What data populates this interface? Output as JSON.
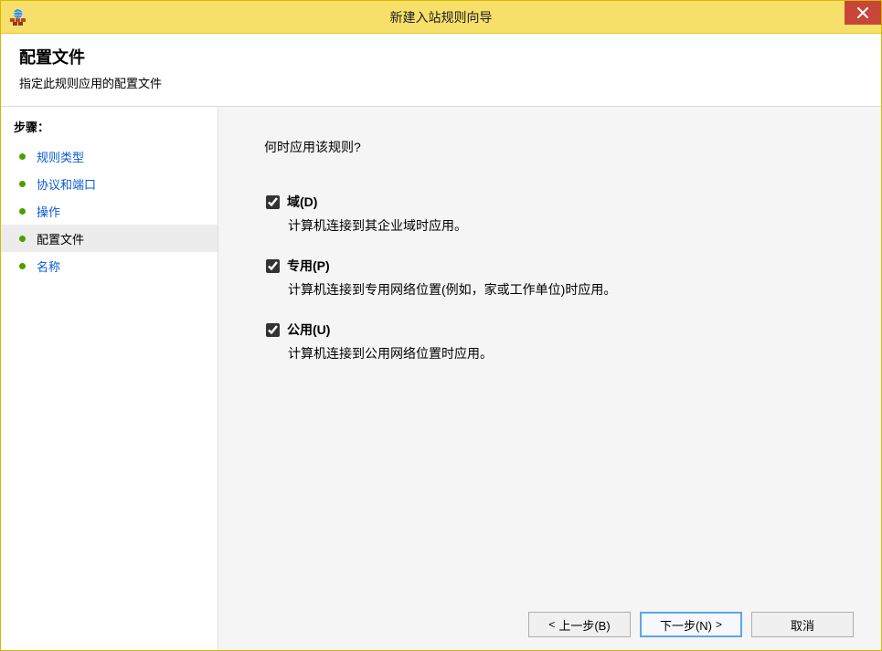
{
  "window": {
    "title": "新建入站规则向导"
  },
  "header": {
    "title": "配置文件",
    "subtitle": "指定此规则应用的配置文件"
  },
  "sidebar": {
    "heading": "步骤：",
    "items": [
      {
        "label": "规则类型",
        "current": false
      },
      {
        "label": "协议和端口",
        "current": false
      },
      {
        "label": "操作",
        "current": false
      },
      {
        "label": "配置文件",
        "current": true
      },
      {
        "label": "名称",
        "current": false
      }
    ]
  },
  "content": {
    "question": "何时应用该规则?",
    "options": [
      {
        "key": "domain",
        "title": "域(D)",
        "desc": "计算机连接到其企业域时应用。",
        "checked": true
      },
      {
        "key": "private",
        "title": "专用(P)",
        "desc": "计算机连接到专用网络位置(例如，家或工作单位)时应用。",
        "checked": true
      },
      {
        "key": "public",
        "title": "公用(U)",
        "desc": "计算机连接到公用网络位置时应用。",
        "checked": true
      }
    ]
  },
  "footer": {
    "back": "上一步(B)",
    "next": "下一步(N)",
    "cancel": "取消"
  }
}
